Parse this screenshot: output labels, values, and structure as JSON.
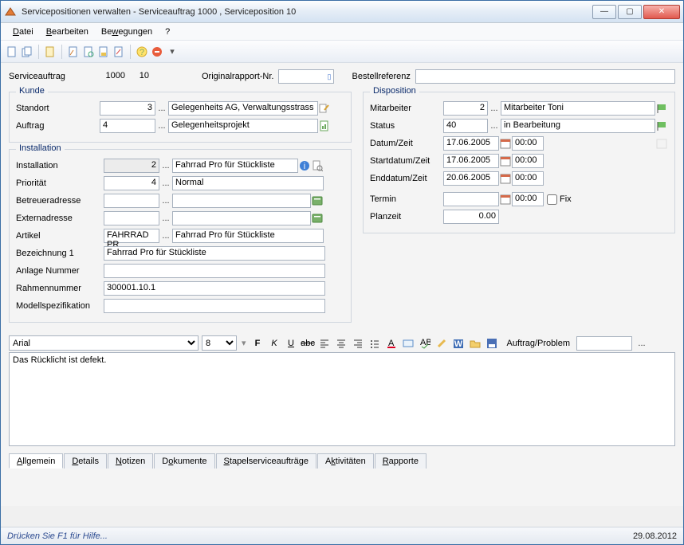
{
  "window": {
    "title": "Servicepositionen verwalten - Serviceauftrag 1000 , Serviceposition 10"
  },
  "menu": {
    "datei": "Datei",
    "bearbeiten": "Bearbeiten",
    "bewegungen": "Bewegungen",
    "help": "?"
  },
  "header": {
    "serviceauftrag_label": "Serviceauftrag",
    "serviceauftrag_nr": "1000",
    "serviceposition_nr": "10",
    "original_label": "Originalrapport-Nr.",
    "original_value": "",
    "bestell_label": "Bestellreferenz",
    "bestell_value": ""
  },
  "kunde": {
    "title": "Kunde",
    "standort_label": "Standort",
    "standort_nr": "3",
    "standort_name": "Gelegenheits AG, Verwaltungsstrass",
    "auftrag_label": "Auftrag",
    "auftrag_nr": "4",
    "auftrag_name": "Gelegenheitsprojekt"
  },
  "installation": {
    "title": "Installation",
    "installation_label": "Installation",
    "installation_nr": "2",
    "installation_name": "Fahrrad Pro für Stückliste",
    "prioritaet_label": "Priorität",
    "prioritaet_nr": "4",
    "prioritaet_name": "Normal",
    "betreuer_label": "Betreueradresse",
    "betreuer_nr": "",
    "betreuer_name": "",
    "extern_label": "Externadresse",
    "extern_nr": "",
    "extern_name": "",
    "artikel_label": "Artikel",
    "artikel_code": "FAHRRAD PR",
    "artikel_name": "Fahrrad Pro für Stückliste",
    "bezeichnung1_label": "Bezeichnung 1",
    "bezeichnung1_value": "Fahrrad Pro für Stückliste",
    "anlage_label": "Anlage Nummer",
    "anlage_value": "",
    "rahmen_label": "Rahmennummer",
    "rahmen_value": "300001.10.1",
    "modell_label": "Modellspezifikation",
    "modell_value": ""
  },
  "disposition": {
    "title": "Disposition",
    "mitarbeiter_label": "Mitarbeiter",
    "mitarbeiter_nr": "2",
    "mitarbeiter_name": "Mitarbeiter Toni",
    "status_label": "Status",
    "status_nr": "40",
    "status_name": "in Bearbeitung",
    "datum_label": "Datum/Zeit",
    "datum_value": "17.06.2005",
    "datum_time": "00:00",
    "start_label": "Startdatum/Zeit",
    "start_value": "17.06.2005",
    "start_time": "00:00",
    "end_label": "Enddatum/Zeit",
    "end_value": "20.06.2005",
    "end_time": "00:00",
    "termin_label": "Termin",
    "termin_value": "",
    "termin_time": "00:00",
    "fix_label": "Fix",
    "planzeit_label": "Planzeit",
    "planzeit_value": "0.00"
  },
  "editor": {
    "font": "Arial",
    "size": "8",
    "auftrag_problem_label": "Auftrag/Problem",
    "auftrag_problem_value": "",
    "body": "Das Rücklicht ist defekt."
  },
  "tabs": {
    "allgemein": "Allgemein",
    "details": "Details",
    "notizen": "Notizen",
    "dokumente": "Dokumente",
    "stapel": "Stapelserviceaufträge",
    "aktivitaeten": "Aktivitäten",
    "rapporte": "Rapporte"
  },
  "statusbar": {
    "help": "Drücken Sie F1 für Hilfe...",
    "date": "29.08.2012"
  }
}
